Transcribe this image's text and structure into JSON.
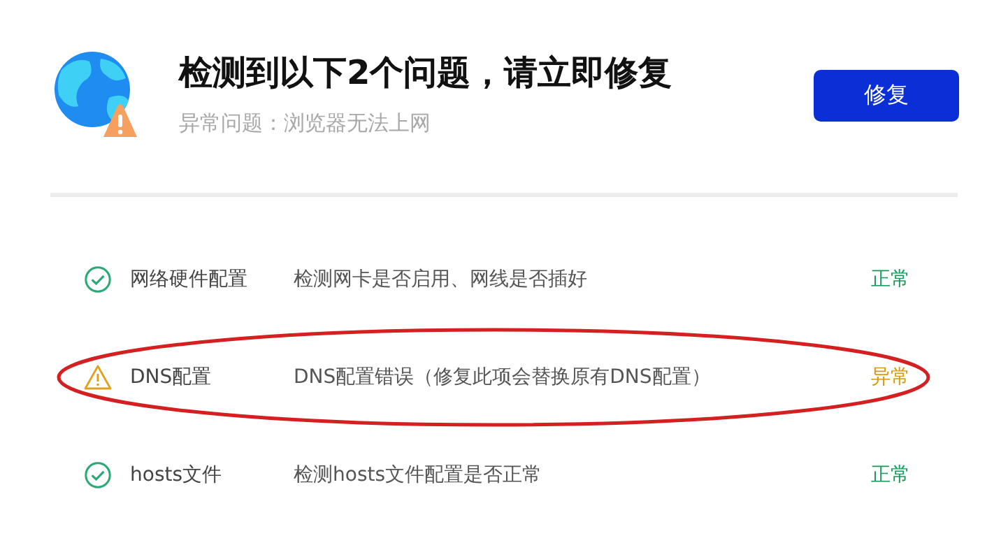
{
  "header": {
    "title": "检测到以下2个问题，请立即修复",
    "subtitle": "异常问题：浏览器无法上网",
    "button": "修复"
  },
  "checks": [
    {
      "name": "网络硬件配置",
      "description": "检测网卡是否启用、网线是否插好",
      "status": "正常",
      "kind": "ok",
      "highlighted": false
    },
    {
      "name": "DNS配置",
      "description": "DNS配置错误（修复此项会替换原有DNS配置）",
      "status": "异常",
      "kind": "warning",
      "highlighted": true
    },
    {
      "name": "hosts文件",
      "description": "检测hosts文件配置是否正常",
      "status": "正常",
      "kind": "ok",
      "highlighted": false
    }
  ]
}
